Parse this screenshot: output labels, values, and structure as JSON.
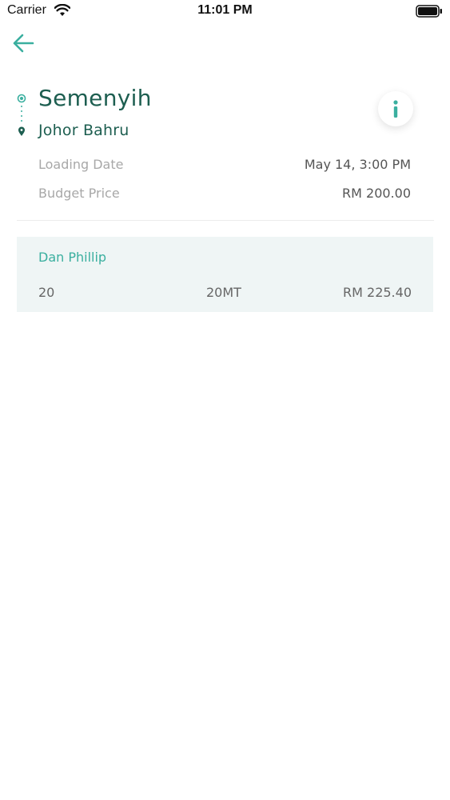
{
  "status_bar": {
    "carrier": "Carrier",
    "time": "11:01 PM"
  },
  "icons": {
    "back": "arrow-left-icon",
    "wifi": "wifi-icon",
    "battery": "battery-icon",
    "origin": "origin-dot-icon",
    "destination": "map-pin-icon",
    "info": "info-icon"
  },
  "colors": {
    "accent": "#3aaf9f",
    "heading": "#1d5e50",
    "card_bg": "#eff5f5"
  },
  "route": {
    "origin": "Semenyih",
    "destination": "Johor Bahru"
  },
  "details": [
    {
      "label": "Loading Date",
      "value": "May 14, 3:00 PM"
    },
    {
      "label": "Budget Price",
      "value": "RM 200.00"
    }
  ],
  "bids": [
    {
      "bidder": "Dan Phillip",
      "quantity": "20",
      "weight": "20MT",
      "price": "RM 225.40"
    }
  ]
}
